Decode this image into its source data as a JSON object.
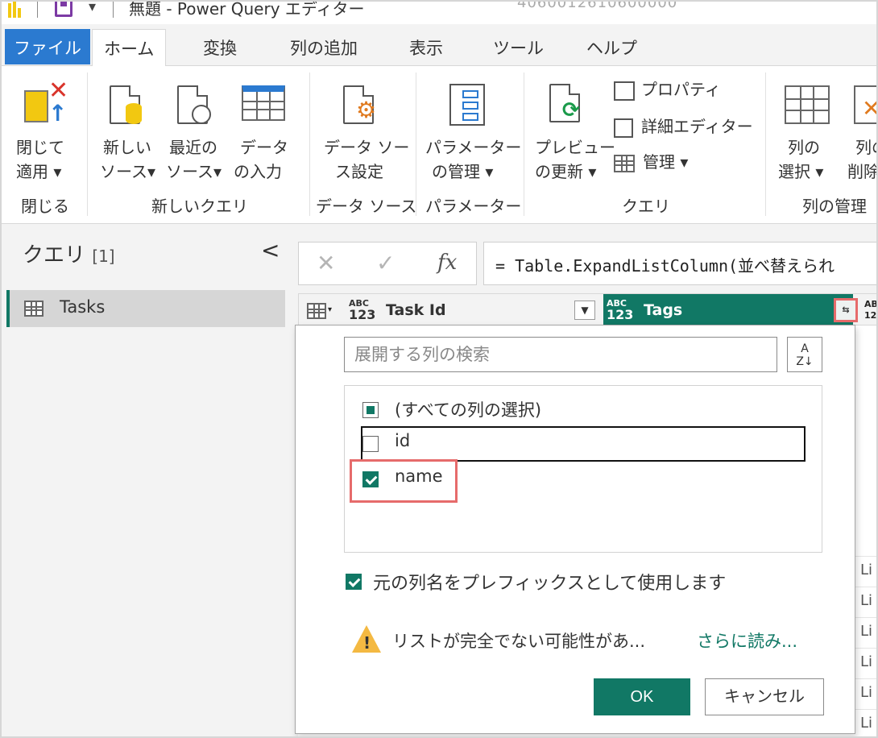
{
  "app": {
    "window_title": "無題 - Power Query エディター",
    "ghost_text": "4060012610600000"
  },
  "tabs": [
    {
      "label": "ファイル"
    },
    {
      "label": "ホーム"
    },
    {
      "label": "変換"
    },
    {
      "label": "列の追加"
    },
    {
      "label": "表示"
    },
    {
      "label": "ツール"
    },
    {
      "label": "ヘルプ"
    }
  ],
  "ribbon": {
    "close_apply": {
      "line1": "閉じて",
      "line2": "適用 ▾"
    },
    "new_source": {
      "line1": "新しい",
      "line2": "ソース▾"
    },
    "recent_sources": {
      "line1": "最近の",
      "line2": "ソース▾"
    },
    "enter_data": {
      "line1": "データ",
      "line2": "の入力"
    },
    "data_source_settings": {
      "line1": "データ ソー",
      "line2": "ス設定"
    },
    "manage_parameters": {
      "line1": "パラメーター",
      "line2": "の管理 ▾"
    },
    "refresh_preview": {
      "line1": "プレビュー",
      "line2": "の更新 ▾"
    },
    "properties": "プロパティ",
    "advanced_editor": "詳細エディター",
    "manage": "管理 ▾",
    "choose_columns": {
      "line1": "列の",
      "line2": "選択 ▾"
    },
    "remove_columns": {
      "line1": "列の",
      "line2": "削除"
    },
    "groups": {
      "close": "閉じる",
      "new_query": "新しいクエリ",
      "data_sources": "データ ソース",
      "parameters": "パラメーター",
      "query": "クエリ",
      "manage_columns": "列の管理"
    }
  },
  "queries_panel": {
    "title": "クエリ",
    "count": "[1]",
    "collapse": "<",
    "items": [
      {
        "label": "Tasks"
      }
    ]
  },
  "formula_bar": {
    "cancel": "✕",
    "confirm": "✓",
    "fx": "fx",
    "formula": "= Table.ExpandListColumn(並べ替えられ"
  },
  "grid": {
    "columns": [
      {
        "type_top": "ABC",
        "type_bottom": "123",
        "name": "Task Id"
      },
      {
        "type_top": "ABC",
        "type_bottom": "123",
        "name": "Tags"
      }
    ],
    "row_stub_values": [
      "Li",
      "Li",
      "Li",
      "Li",
      "Li",
      "Li"
    ]
  },
  "expand_dropdown": {
    "search_placeholder": "展開する列の検索",
    "sort_label_top": "A",
    "sort_label_bottom": "Z↓",
    "select_all": "(すべての列の選択)",
    "items": [
      {
        "label": "id",
        "checked": false
      },
      {
        "label": "name",
        "checked": true
      }
    ],
    "prefix_option": "元の列名をプレフィックスとして使用します",
    "warning": "リストが完全でない可能性があ...",
    "load_more": "さらに読み...",
    "ok": "OK",
    "cancel": "キャンセル"
  },
  "colors": {
    "accent": "#117865",
    "file_tab": "#2b7ad0",
    "highlight": "#e66b6b",
    "warning": "#f4b942"
  }
}
